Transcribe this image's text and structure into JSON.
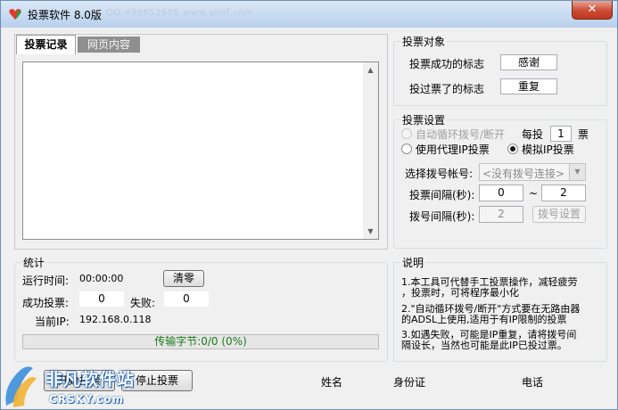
{
  "window": {
    "title": "投票软件 8.0版",
    "title_watermark": "QQ:499652688  www.ahlif.com",
    "close_symbol": "✕"
  },
  "tabs": [
    {
      "label": "投票记录",
      "active": true
    },
    {
      "label": "网页内容",
      "active": false
    }
  ],
  "vote_target": {
    "title": "投票对象",
    "success_label": "投票成功的标志",
    "success_value": "感谢",
    "voted_label": "投过票了的标志",
    "voted_value": "重复"
  },
  "vote_settings": {
    "title": "投票设置",
    "auto_dial_label": "自动循环拨号/断开",
    "per_label": "每投",
    "per_value": "1",
    "per_unit": "票",
    "proxy_label": "使用代理IP投票",
    "simulate_label": "模拟IP投票",
    "selected_mode": "simulate",
    "dial_account_label": "选择拨号帐号:",
    "dial_account_value": "<没有拨号连接>",
    "interval_label": "投票间隔(秒):",
    "interval_min": "0",
    "interval_sep": "~",
    "interval_max": "2",
    "dial_interval_label": "拨号间隔(秒):",
    "dial_interval_value": "2",
    "dial_settings_button": "拨号设置"
  },
  "stats": {
    "title": "统计",
    "runtime_label": "运行时间:",
    "runtime_value": "00:00:00",
    "clear_button": "清零",
    "success_label": "成功投票:",
    "success_value": "0",
    "fail_label": "失败:",
    "fail_value": "0",
    "ip_label": "当前IP:",
    "ip_value": "192.168.0.118",
    "progress_text": "传输字节:0/0 (0%)",
    "progress_fraction": 0
  },
  "notes": {
    "title": "说明",
    "lines": [
      "1.本工具可代替手工投票操作，减轻疲劳",
      "，投票时，可将程序最小化",
      "2.\"自动循环拨号/断开\"方式要在无路由器",
      "的ADSL上使用,适用于有IP限制的投票",
      "3.如遇失败，可能是IP重复，请将拨号间",
      "隔设长，当然也可能是此IP已投过票。"
    ]
  },
  "bottom": {
    "start_button": "开始投票",
    "stop_button": "停止投票",
    "col_name": "姓名",
    "col_id": "身份证",
    "col_phone": "电话"
  },
  "watermark": {
    "text": "非凡软件站",
    "sub": "CRSKY.com"
  },
  "colors": {
    "titlebar": "#c9dcf2",
    "close_button": "#cc4b33",
    "progress_green": "#06b025",
    "logo_blue": "#1a5fb0"
  }
}
